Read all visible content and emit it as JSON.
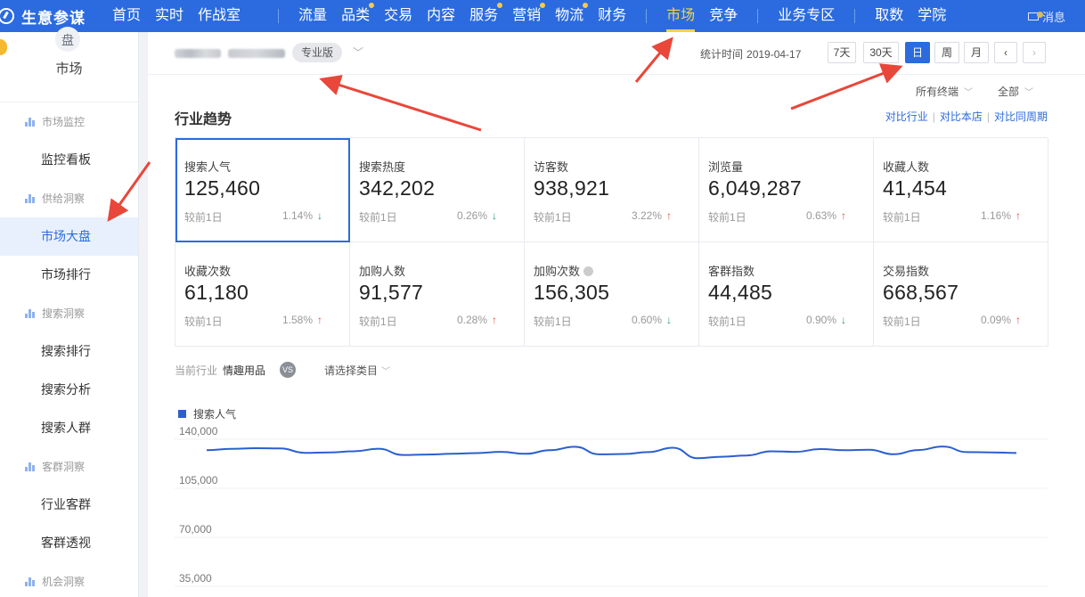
{
  "app": {
    "title": "生意参谋"
  },
  "nav": {
    "group1": [
      {
        "label": "首页",
        "dot": false
      },
      {
        "label": "实时",
        "dot": false
      },
      {
        "label": "作战室",
        "dot": false
      }
    ],
    "group2": [
      {
        "label": "流量",
        "dot": false
      },
      {
        "label": "品类",
        "dot": true
      },
      {
        "label": "交易",
        "dot": false
      },
      {
        "label": "内容",
        "dot": false
      },
      {
        "label": "服务",
        "dot": true
      },
      {
        "label": "营销",
        "dot": true
      },
      {
        "label": "物流",
        "dot": true
      },
      {
        "label": "财务",
        "dot": false
      }
    ],
    "group3": [
      {
        "label": "市场",
        "active": true
      },
      {
        "label": "竞争",
        "active": false
      }
    ],
    "group4": [
      {
        "label": "业务专区"
      }
    ],
    "group5": [
      {
        "label": "取数"
      },
      {
        "label": "学院"
      }
    ],
    "message": "消息"
  },
  "sidebar": {
    "emblem": "盘",
    "title": "市场",
    "sections": [
      {
        "label": "市场监控",
        "items": [
          "监控看板"
        ]
      },
      {
        "label": "供给洞察",
        "items": [
          "市场大盘",
          "市场排行"
        ]
      },
      {
        "label": "搜索洞察",
        "items": [
          "搜索排行",
          "搜索分析",
          "搜索人群"
        ]
      },
      {
        "label": "客群洞察",
        "items": [
          "行业客群",
          "客群透视"
        ]
      },
      {
        "label": "机会洞察",
        "items": []
      }
    ],
    "active_item": "市场大盘"
  },
  "header": {
    "badge": "专业版",
    "stat_label": "统计时间",
    "stat_date": "2019-04-17",
    "periods": [
      "7天",
      "30天",
      "日",
      "周",
      "月"
    ],
    "active_period": "日",
    "prev": "‹",
    "next": "›"
  },
  "filters": {
    "terminal": "所有终端",
    "scope": "全部"
  },
  "section": {
    "title": "行业趋势",
    "compare": [
      "对比行业",
      "对比本店",
      "对比同周期"
    ]
  },
  "metrics": [
    {
      "name": "搜索人气",
      "value": "125,460",
      "cmp": "较前1日",
      "pct": "1.14%",
      "dir": "down"
    },
    {
      "name": "搜索热度",
      "value": "342,202",
      "cmp": "较前1日",
      "pct": "0.26%",
      "dir": "down"
    },
    {
      "name": "访客数",
      "value": "938,921",
      "cmp": "较前1日",
      "pct": "3.22%",
      "dir": "up"
    },
    {
      "name": "浏览量",
      "value": "6,049,287",
      "cmp": "较前1日",
      "pct": "0.63%",
      "dir": "up"
    },
    {
      "name": "收藏人数",
      "value": "41,454",
      "cmp": "较前1日",
      "pct": "1.16%",
      "dir": "up"
    },
    {
      "name": "收藏次数",
      "value": "61,180",
      "cmp": "较前1日",
      "pct": "1.58%",
      "dir": "up"
    },
    {
      "name": "加购人数",
      "value": "91,577",
      "cmp": "较前1日",
      "pct": "0.28%",
      "dir": "up"
    },
    {
      "name": "加购次数",
      "value": "156,305",
      "cmp": "较前1日",
      "pct": "0.60%",
      "dir": "down"
    },
    {
      "name": "客群指数",
      "value": "44,485",
      "cmp": "较前1日",
      "pct": "0.90%",
      "dir": "down"
    },
    {
      "name": "交易指数",
      "value": "668,567",
      "cmp": "较前1日",
      "pct": "0.09%",
      "dir": "up"
    }
  ],
  "industry": {
    "label": "当前行业",
    "value": "情趣用品",
    "vs": "VS",
    "category_placeholder": "请选择类目"
  },
  "colors": {
    "brand": "#2b6bdf",
    "up": "#e04b3c",
    "down": "#1aa05a",
    "active_nav": "#f7d24a",
    "line": "#2b5fd0",
    "arrow": "#e8473a"
  },
  "chart_data": {
    "type": "line",
    "legend_position": "top-left",
    "grid": true,
    "yticks": [
      "140,000",
      "105,000",
      "70,000",
      "35,000"
    ],
    "ylim": [
      35000,
      140000
    ],
    "series": [
      {
        "name": "搜索人气",
        "values": [
          126500,
          127400,
          127900,
          127700,
          124600,
          124900,
          125700,
          127500,
          123100,
          123400,
          123900,
          124400,
          125300,
          123900,
          126500,
          128900,
          123500,
          123800,
          125100,
          128200,
          120800,
          121800,
          122700,
          125700,
          125300,
          127300,
          126500,
          126800,
          123600,
          126600,
          129100,
          125100,
          124900,
          124500
        ]
      }
    ]
  }
}
